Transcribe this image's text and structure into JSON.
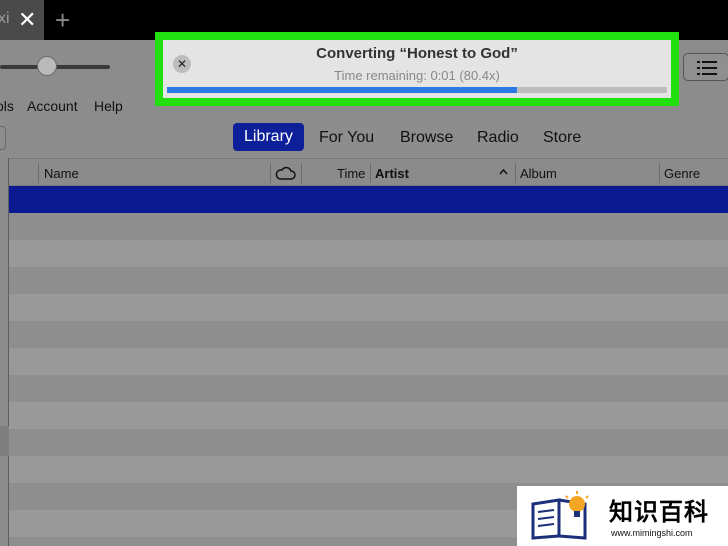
{
  "browser": {
    "tab_title": "xi",
    "tab_close": "✕",
    "new_tab": "+"
  },
  "toolbar": {
    "volume_level": 0.43
  },
  "menu": {
    "items": [
      "ols",
      "Account",
      "Help"
    ]
  },
  "nav": {
    "items": [
      {
        "label": "Library",
        "active": true
      },
      {
        "label": "For You",
        "active": false
      },
      {
        "label": "Browse",
        "active": false
      },
      {
        "label": "Radio",
        "active": false
      },
      {
        "label": "Store",
        "active": false
      }
    ]
  },
  "columns": {
    "name": "Name",
    "time": "Time",
    "artist": "Artist",
    "album": "Album",
    "genre": "Genre"
  },
  "dialog": {
    "close": "✕",
    "title": "Converting “Honest to God”",
    "subtitle": "Time remaining: 0:01 (80.4x)",
    "progress": 0.7
  },
  "watermark": {
    "text": "知识百科",
    "url": "www.mimingshi.com"
  },
  "colors": {
    "highlight": "#22e010",
    "selected_row": "#0b1a91",
    "active_tab": "#0e1f9a",
    "progress": "#2a79e4"
  }
}
